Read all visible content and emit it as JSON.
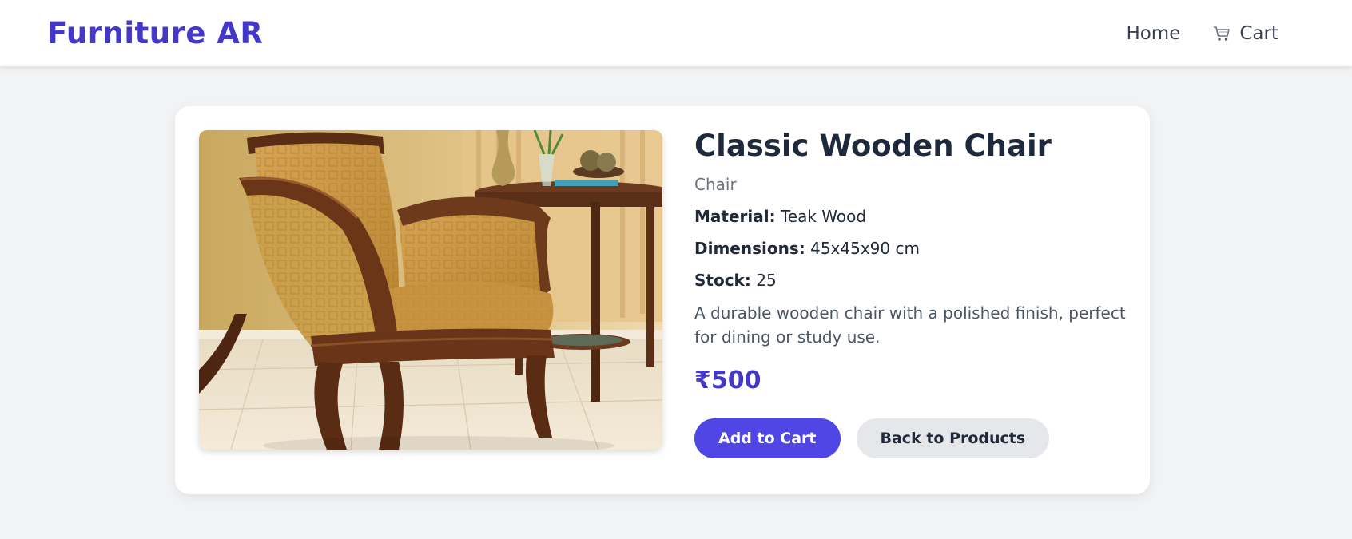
{
  "navbar": {
    "brand": "Furniture AR",
    "links": [
      {
        "label": "Home"
      },
      {
        "label": "Cart",
        "icon": "cart-icon"
      }
    ]
  },
  "product": {
    "image_alt": "Classic Wooden Chair",
    "name": "Classic Wooden Chair",
    "category": "Chair",
    "specs": {
      "material_label": "Material:",
      "material": "Teak Wood",
      "dimensions_label": "Dimensions:",
      "dimensions": "45x45x90 cm",
      "stock_label": "Stock:",
      "stock": "25"
    },
    "description": "A durable wooden chair with a polished finish, perfect for dining or study use.",
    "price": "₹500"
  },
  "actions": {
    "add_to_cart": "Add to Cart",
    "back": "Back to Products"
  },
  "colors": {
    "brand": "#4338ca",
    "primary_button": "#4f46e5",
    "secondary_button": "#e5e7eb",
    "page_background": "#f2f3f5"
  }
}
